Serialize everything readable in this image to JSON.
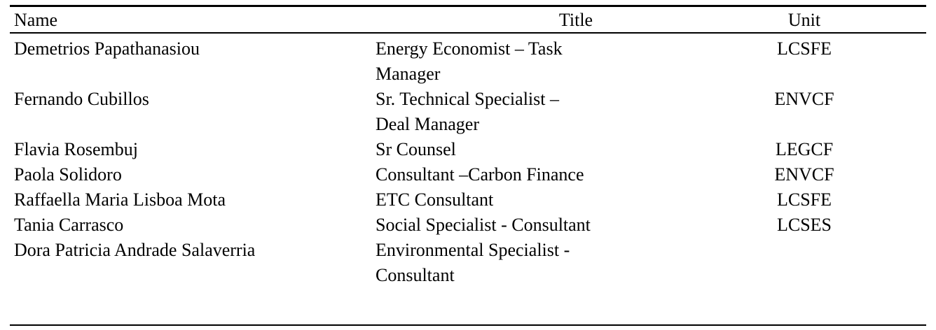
{
  "table": {
    "headers": {
      "name": "Name",
      "title": "Title",
      "unit": "Unit"
    },
    "rows": [
      {
        "name": "Demetrios Papathanasiou",
        "title_lines": [
          "Energy Economist – Task",
          "Manager"
        ],
        "unit": "LCSFE"
      },
      {
        "name": "Fernando Cubillos",
        "title_lines": [
          "Sr. Technical Specialist –",
          "Deal Manager"
        ],
        "unit": "ENVCF"
      },
      {
        "name": "Flavia Rosembuj",
        "title_lines": [
          "Sr Counsel"
        ],
        "unit": "LEGCF"
      },
      {
        "name": "Paola Solidoro",
        "title_lines": [
          "Consultant –Carbon Finance"
        ],
        "unit": "ENVCF"
      },
      {
        "name": "Raffaella Maria Lisboa Mota",
        "title_lines": [
          "ETC Consultant"
        ],
        "unit": "LCSFE"
      },
      {
        "name": "Tania Carrasco",
        "title_lines": [
          "Social Specialist - Consultant"
        ],
        "unit": "LCSES"
      },
      {
        "name": "Dora Patricia Andrade Salaverria",
        "title_lines": [
          "Environmental Specialist -",
          "Consultant"
        ],
        "unit": ""
      }
    ]
  }
}
